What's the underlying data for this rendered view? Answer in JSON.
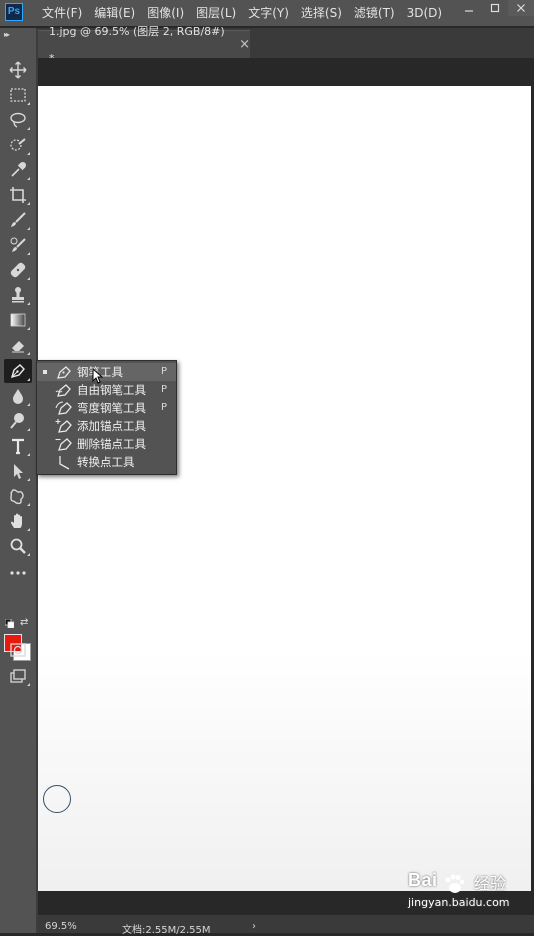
{
  "app": {
    "logo": "Ps"
  },
  "menu": [
    "文件(F)",
    "编辑(E)",
    "图像(I)",
    "图层(L)",
    "文字(Y)",
    "选择(S)",
    "滤镜(T)",
    "3D(D)"
  ],
  "window_controls": [
    "minimize-icon",
    "restore-icon",
    "close-icon"
  ],
  "document_tab": {
    "title": "1.jpg @ 69.5% (图层 2, RGB/8#) *",
    "close": "×"
  },
  "toolbar": {
    "tools": [
      "move-icon",
      "marquee-icon",
      "lasso-icon",
      "quick-select-icon",
      "eyedropper-icon",
      "crop-icon",
      "brush-icon",
      "healing-icon",
      "patch-icon",
      "stamp-icon",
      "gradient-icon",
      "eraser-icon",
      "pen-icon",
      "blur-icon",
      "dodge-icon",
      "type-icon",
      "path-select-icon",
      "shape-icon",
      "hand-icon",
      "zoom-icon",
      "more-icon"
    ],
    "foreground_color": "#e8190e",
    "background_color": "#ffffff"
  },
  "flyout": {
    "items": [
      {
        "label": "钢笔工具",
        "key": "P",
        "icon": "pen-icon",
        "selected": true
      },
      {
        "label": "自由钢笔工具",
        "key": "P",
        "icon": "freeform-pen-icon",
        "selected": false
      },
      {
        "label": "弯度钢笔工具",
        "key": "P",
        "icon": "curvature-pen-icon",
        "selected": false
      },
      {
        "label": "添加锚点工具",
        "key": "",
        "icon": "add-anchor-icon",
        "selected": false
      },
      {
        "label": "删除锚点工具",
        "key": "",
        "icon": "delete-anchor-icon",
        "selected": false
      },
      {
        "label": "转换点工具",
        "key": "",
        "icon": "convert-point-icon",
        "selected": false
      }
    ]
  },
  "status": {
    "zoom": "69.5%",
    "doc_size": "文档:2.55M/2.55M",
    "arrow": "›"
  },
  "watermark": {
    "brand": "Bai",
    "site": "经验",
    "url": "jingyan.baidu.com"
  }
}
